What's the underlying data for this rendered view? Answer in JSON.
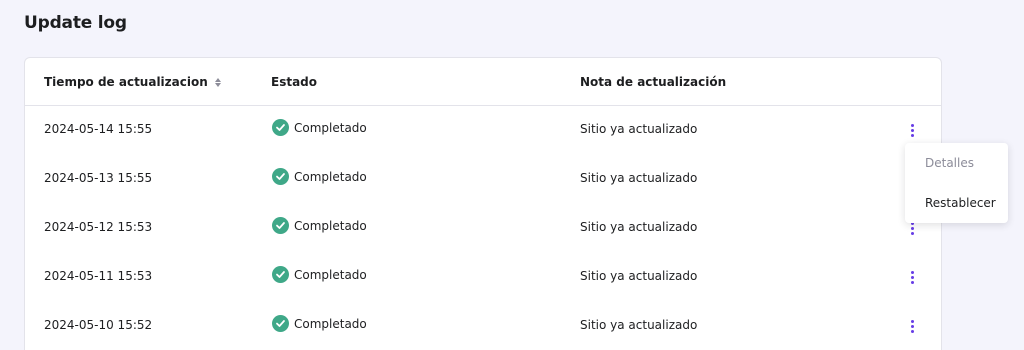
{
  "page": {
    "title": "Update log"
  },
  "table": {
    "columns": {
      "time": "Tiempo de actualizacion",
      "status": "Estado",
      "note": "Nota de actualización"
    },
    "rows": [
      {
        "time": "2024-05-14 15:55",
        "status": "Completado",
        "note": "Sitio ya actualizado"
      },
      {
        "time": "2024-05-13 15:55",
        "status": "Completado",
        "note": "Sitio ya actualizado"
      },
      {
        "time": "2024-05-12 15:53",
        "status": "Completado",
        "note": "Sitio ya actualizado"
      },
      {
        "time": "2024-05-11 15:53",
        "status": "Completado",
        "note": "Sitio ya actualizado"
      },
      {
        "time": "2024-05-10 15:52",
        "status": "Completado",
        "note": "Sitio ya actualizado"
      }
    ]
  },
  "menu": {
    "items": [
      {
        "label": "Detalles",
        "state": "disabled"
      },
      {
        "label": "Restablecer",
        "state": "enabled"
      }
    ]
  },
  "colors": {
    "background": "#f4f4fc",
    "success": "#3fa888",
    "accent": "#673de6",
    "text": "#1d1e20",
    "muted": "#8c8c99"
  },
  "icons": {
    "sort": "sort-icon",
    "status": "check-circle-icon",
    "actions": "kebab-menu-icon"
  }
}
